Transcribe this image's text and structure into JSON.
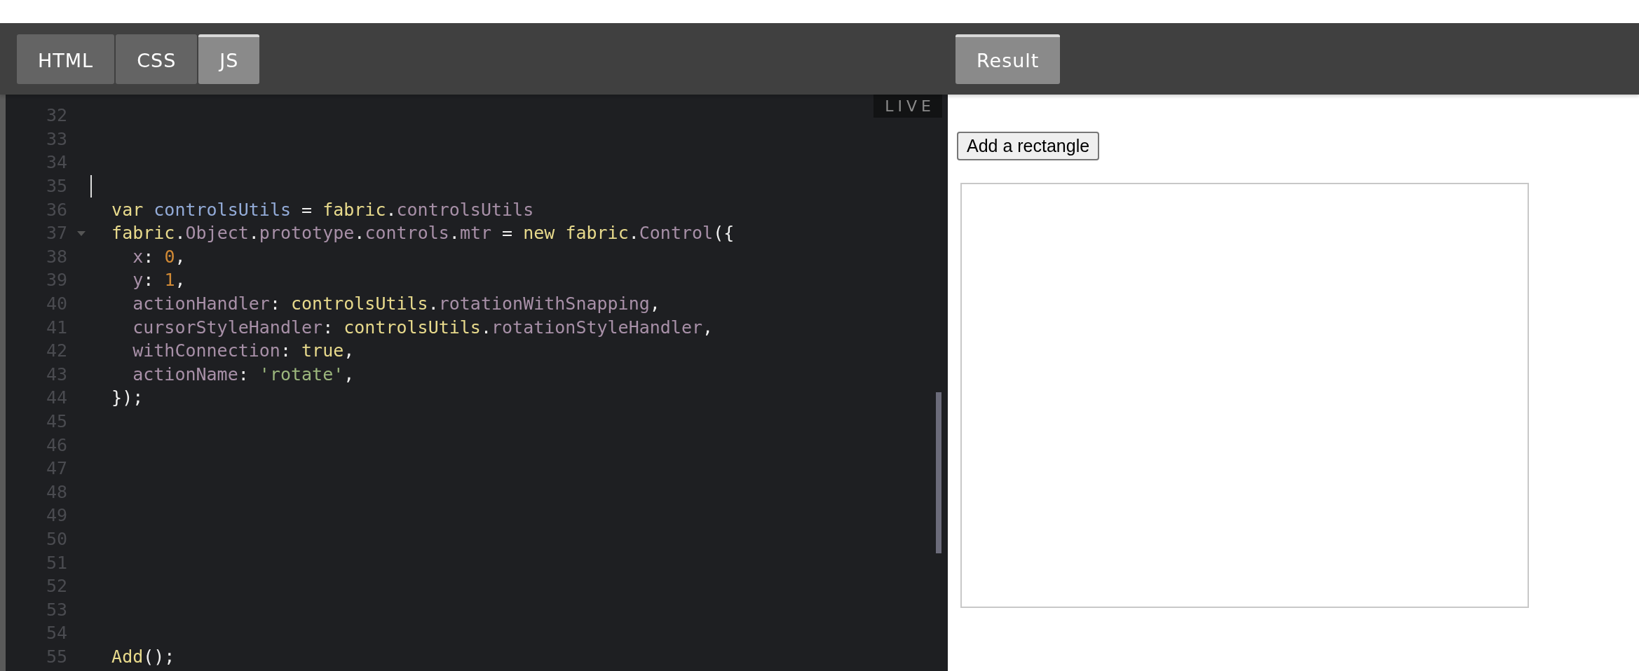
{
  "tabs": [
    {
      "label": "HTML",
      "selected": false
    },
    {
      "label": "CSS",
      "selected": false
    },
    {
      "label": "JS",
      "selected": true
    }
  ],
  "result_tab": {
    "label": "Result",
    "selected": true
  },
  "editor": {
    "badge": "LIVE",
    "lines": [
      {
        "number": "32",
        "cursor": false,
        "foldable": false
      },
      {
        "number": "33",
        "cursor": false,
        "foldable": false
      },
      {
        "number": "34",
        "cursor": false,
        "foldable": false
      },
      {
        "number": "35",
        "cursor": true,
        "foldable": false
      },
      {
        "number": "36",
        "cursor": false,
        "foldable": false,
        "tokens": [
          {
            "text": "  var",
            "kind": "kw"
          },
          {
            "text": " controlsUtils",
            "kind": "var"
          },
          {
            "text": " = ",
            "kind": "punct"
          },
          {
            "text": "fabric",
            "kind": "obj"
          },
          {
            "text": ".",
            "kind": "punct"
          },
          {
            "text": "controlsUtils",
            "kind": "prop"
          }
        ]
      },
      {
        "number": "37",
        "cursor": false,
        "foldable": true,
        "tokens": [
          {
            "text": "  fabric",
            "kind": "obj"
          },
          {
            "text": ".",
            "kind": "punct"
          },
          {
            "text": "Object",
            "kind": "prop"
          },
          {
            "text": ".",
            "kind": "punct"
          },
          {
            "text": "prototype",
            "kind": "prop"
          },
          {
            "text": ".",
            "kind": "punct"
          },
          {
            "text": "controls",
            "kind": "prop"
          },
          {
            "text": ".",
            "kind": "punct"
          },
          {
            "text": "mtr",
            "kind": "prop"
          },
          {
            "text": " = ",
            "kind": "punct"
          },
          {
            "text": "new",
            "kind": "kw"
          },
          {
            "text": " fabric",
            "kind": "obj"
          },
          {
            "text": ".",
            "kind": "punct"
          },
          {
            "text": "Control",
            "kind": "prop"
          },
          {
            "text": "({",
            "kind": "punct"
          }
        ]
      },
      {
        "number": "38",
        "cursor": false,
        "foldable": false,
        "tokens": [
          {
            "text": "    x",
            "kind": "prop"
          },
          {
            "text": ": ",
            "kind": "punct"
          },
          {
            "text": "0",
            "kind": "num"
          },
          {
            "text": ",",
            "kind": "punct"
          }
        ]
      },
      {
        "number": "39",
        "cursor": false,
        "foldable": false,
        "tokens": [
          {
            "text": "    y",
            "kind": "prop"
          },
          {
            "text": ": ",
            "kind": "punct"
          },
          {
            "text": "1",
            "kind": "num"
          },
          {
            "text": ",",
            "kind": "punct"
          }
        ]
      },
      {
        "number": "40",
        "cursor": false,
        "foldable": false,
        "tokens": [
          {
            "text": "    actionHandler",
            "kind": "prop"
          },
          {
            "text": ": ",
            "kind": "punct"
          },
          {
            "text": "controlsUtils",
            "kind": "obj"
          },
          {
            "text": ".",
            "kind": "punct"
          },
          {
            "text": "rotationWithSnapping",
            "kind": "prop"
          },
          {
            "text": ",",
            "kind": "punct"
          }
        ]
      },
      {
        "number": "41",
        "cursor": false,
        "foldable": false,
        "tokens": [
          {
            "text": "    cursorStyleHandler",
            "kind": "prop"
          },
          {
            "text": ": ",
            "kind": "punct"
          },
          {
            "text": "controlsUtils",
            "kind": "obj"
          },
          {
            "text": ".",
            "kind": "punct"
          },
          {
            "text": "rotationStyleHandler",
            "kind": "prop"
          },
          {
            "text": ",",
            "kind": "punct"
          }
        ]
      },
      {
        "number": "42",
        "cursor": false,
        "foldable": false,
        "tokens": [
          {
            "text": "    withConnection",
            "kind": "prop"
          },
          {
            "text": ": ",
            "kind": "punct"
          },
          {
            "text": "true",
            "kind": "kw"
          },
          {
            "text": ",",
            "kind": "punct"
          }
        ]
      },
      {
        "number": "43",
        "cursor": false,
        "foldable": false,
        "tokens": [
          {
            "text": "    actionName",
            "kind": "prop"
          },
          {
            "text": ": ",
            "kind": "punct"
          },
          {
            "text": "'rotate'",
            "kind": "str"
          },
          {
            "text": ",",
            "kind": "punct"
          }
        ]
      },
      {
        "number": "44",
        "cursor": false,
        "foldable": false,
        "tokens": [
          {
            "text": "  });",
            "kind": "punct"
          }
        ]
      },
      {
        "number": "45",
        "cursor": false,
        "foldable": false
      },
      {
        "number": "46",
        "cursor": false,
        "foldable": false
      },
      {
        "number": "47",
        "cursor": false,
        "foldable": false
      },
      {
        "number": "48",
        "cursor": false,
        "foldable": false
      },
      {
        "number": "49",
        "cursor": false,
        "foldable": false
      },
      {
        "number": "50",
        "cursor": false,
        "foldable": false
      },
      {
        "number": "51",
        "cursor": false,
        "foldable": false
      },
      {
        "number": "52",
        "cursor": false,
        "foldable": false
      },
      {
        "number": "53",
        "cursor": false,
        "foldable": false
      },
      {
        "number": "54",
        "cursor": false,
        "foldable": false
      },
      {
        "number": "55",
        "cursor": false,
        "foldable": false,
        "tokens": [
          {
            "text": "  Add",
            "kind": "obj"
          },
          {
            "text": "();",
            "kind": "punct"
          }
        ]
      }
    ]
  },
  "result": {
    "button": "Add a rectangle"
  }
}
